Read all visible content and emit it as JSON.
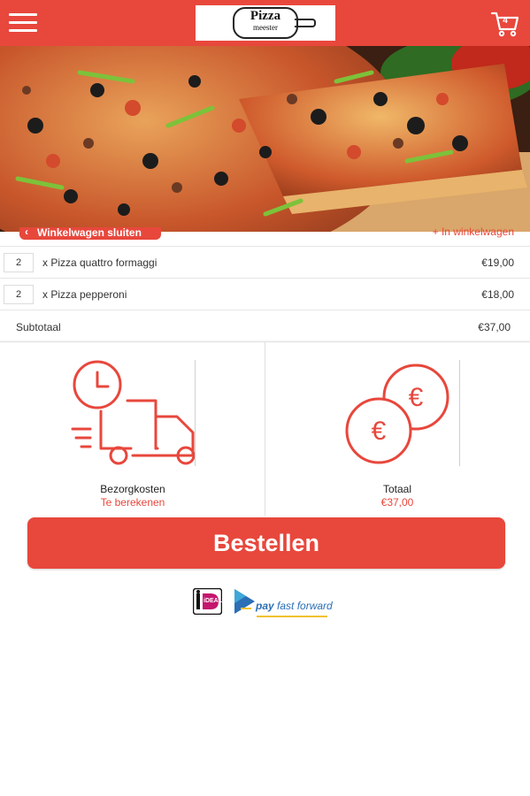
{
  "header": {
    "menu_icon": "hamburger-menu-icon",
    "logo_line1": "Pizza",
    "logo_line2": "meester",
    "cart_icon": "shopping-cart-icon",
    "cart_count": "4",
    "bar_color": "#e8473c"
  },
  "hero": {
    "image": "pizza-photo"
  },
  "nav": {
    "back_label": "Winkelwagen sluiten",
    "cart_link_label": "+ In winkelwagen"
  },
  "order": {
    "items": [
      {
        "qty": "2",
        "name": "x Pizza quattro formaggi",
        "price": "€19,00"
      },
      {
        "qty": "2",
        "name": "x Pizza pepperoni",
        "price": "€18,00"
      }
    ],
    "subtotal_label": "Subtotaal",
    "subtotal_value": "€37,00"
  },
  "summary": {
    "delivery_icon": "delivery-truck-clock-icon",
    "delivery_label": "Bezorgkosten",
    "delivery_value": "Te berekenen",
    "total_icon": "euro-coins-icon",
    "total_label": "Totaal",
    "total_value": "€37,00"
  },
  "checkout": {
    "button_label": "Bestellen"
  },
  "payment": {
    "ideal_icon": "ideal-logo",
    "ideal_text": "iDEAL",
    "pff_icon": "pay-fast-forward-logo",
    "pff_pay": "pay",
    "pff_rest": "fast forward"
  },
  "colors": {
    "accent": "#e8473c"
  }
}
